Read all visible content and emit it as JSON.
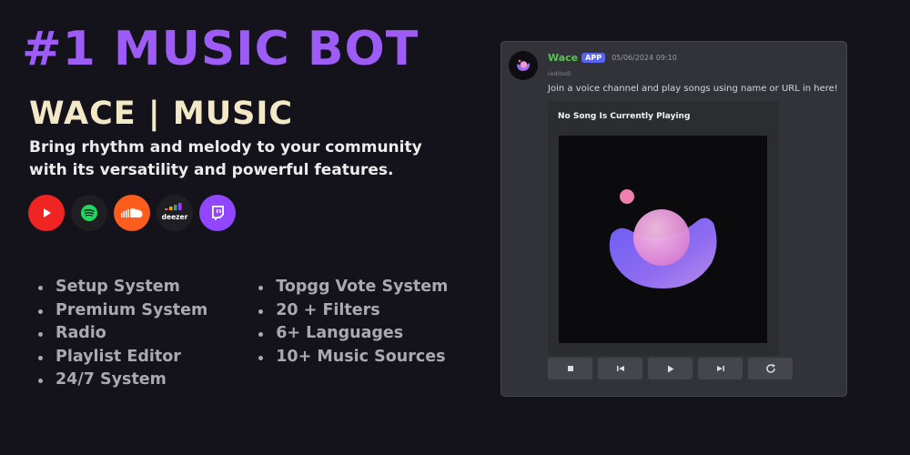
{
  "hero": {
    "title": "#1 MUSIC BOT",
    "bot_name": "WACE | MUSIC",
    "tagline": "Bring rhythm and melody to your community with its versatility and powerful features."
  },
  "sources": [
    {
      "icon": "youtube-icon",
      "color": "#f12424"
    },
    {
      "icon": "spotify-icon",
      "color": "#1f1e23"
    },
    {
      "icon": "soundcloud-icon",
      "color": "#fc5d1c"
    },
    {
      "icon": "deezer-icon",
      "color": "#1f1e23",
      "label": "deezer"
    },
    {
      "icon": "twitch-icon",
      "color": "#9146ff"
    }
  ],
  "features": {
    "left": [
      "Setup System",
      "Premium System",
      "Radio",
      "Playlist Editor",
      "24/7 System"
    ],
    "right": [
      "Topgg Vote System",
      "20 + Filters",
      "6+ Languages",
      "10+ Music Sources"
    ]
  },
  "message": {
    "author": "Wace",
    "badge": "APP",
    "timestamp": "05/06/2024 09:10",
    "edited": "(edited)",
    "text": "Join a voice channel and play songs using name or URL in here!",
    "embed_title": "No Song Is Currently Playing",
    "author_color": "#57c54f"
  },
  "controls": [
    {
      "icon": "stop-icon"
    },
    {
      "icon": "previous-icon"
    },
    {
      "icon": "play-icon"
    },
    {
      "icon": "next-icon"
    },
    {
      "icon": "loop-icon"
    }
  ],
  "colors": {
    "accent": "#9d5cf5",
    "bot_name": "#f3e9c7",
    "background": "#14131b"
  }
}
